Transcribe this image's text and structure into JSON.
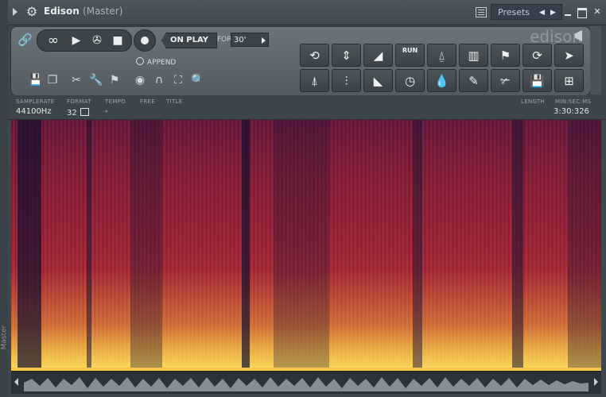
{
  "window": {
    "title": "Edison",
    "subtitle": "(Master)",
    "presets_label": "Presets",
    "side_label": "Master"
  },
  "logo": "edison",
  "transport": {
    "on_play_label": "ON PLAY",
    "for_label": "FOR",
    "for_value": "30'",
    "append_label": "APPEND"
  },
  "tool_grid": {
    "run_label": "RUN",
    "icons_row1": [
      "rotate-ccw-icon",
      "normalize-icon",
      "fade-in-icon",
      "run-icon",
      "declick-icon",
      "equalize-icon",
      "marker-add-icon",
      "refresh-icon",
      "select-cursor-icon"
    ],
    "icons_row2": [
      "amplify-icon",
      "noise-gate-icon",
      "fade-out-icon",
      "time-stretch-icon",
      "drop-icon",
      "feather-icon",
      "slice-icon",
      "save-region-icon",
      "settings-icon"
    ]
  },
  "info": {
    "samplerate_label": "SAMPLERATE",
    "samplerate_value": "44100Hz",
    "format_label": "FORMAT",
    "format_value": "32",
    "tempo_label": "TEMPO",
    "tempo_value": "-",
    "free_label": "FREE",
    "title_label": "TITLE",
    "length_label": "LENGTH",
    "time_format_label": "MIN:SEC:MS",
    "length_value": "3:30:326"
  },
  "colors": {
    "spectro_low": "#6a1840",
    "spectro_mid": "#a0243a",
    "spectro_high": "#f5c84a"
  }
}
